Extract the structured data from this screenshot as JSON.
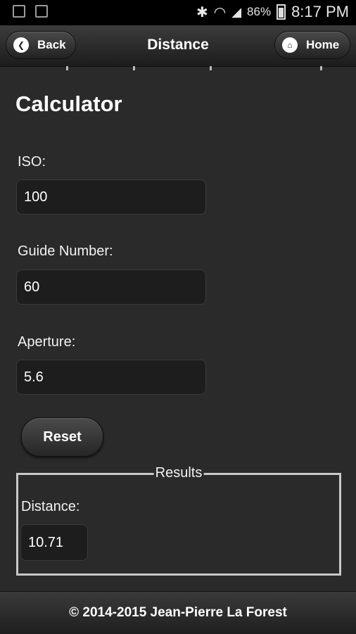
{
  "status_bar": {
    "battery_percent": "86%",
    "time": "8:17 PM",
    "icons": [
      "screencast-icon",
      "gallery-icon",
      "bluetooth-icon",
      "wifi-icon",
      "signal-icon",
      "battery-icon"
    ]
  },
  "header": {
    "back_label": "Back",
    "title": "Distance",
    "home_label": "Home"
  },
  "main": {
    "title": "Calculator",
    "fields": [
      {
        "label": "ISO:",
        "value": "100"
      },
      {
        "label": "Guide Number:",
        "value": "60"
      },
      {
        "label": "Aperture:",
        "value": "5.6"
      }
    ],
    "reset_label": "Reset",
    "results": {
      "legend": "Results",
      "label": "Distance:",
      "value": "10.71"
    }
  },
  "footer": {
    "text": "© 2014-2015 Jean-Pierre La Forest"
  }
}
